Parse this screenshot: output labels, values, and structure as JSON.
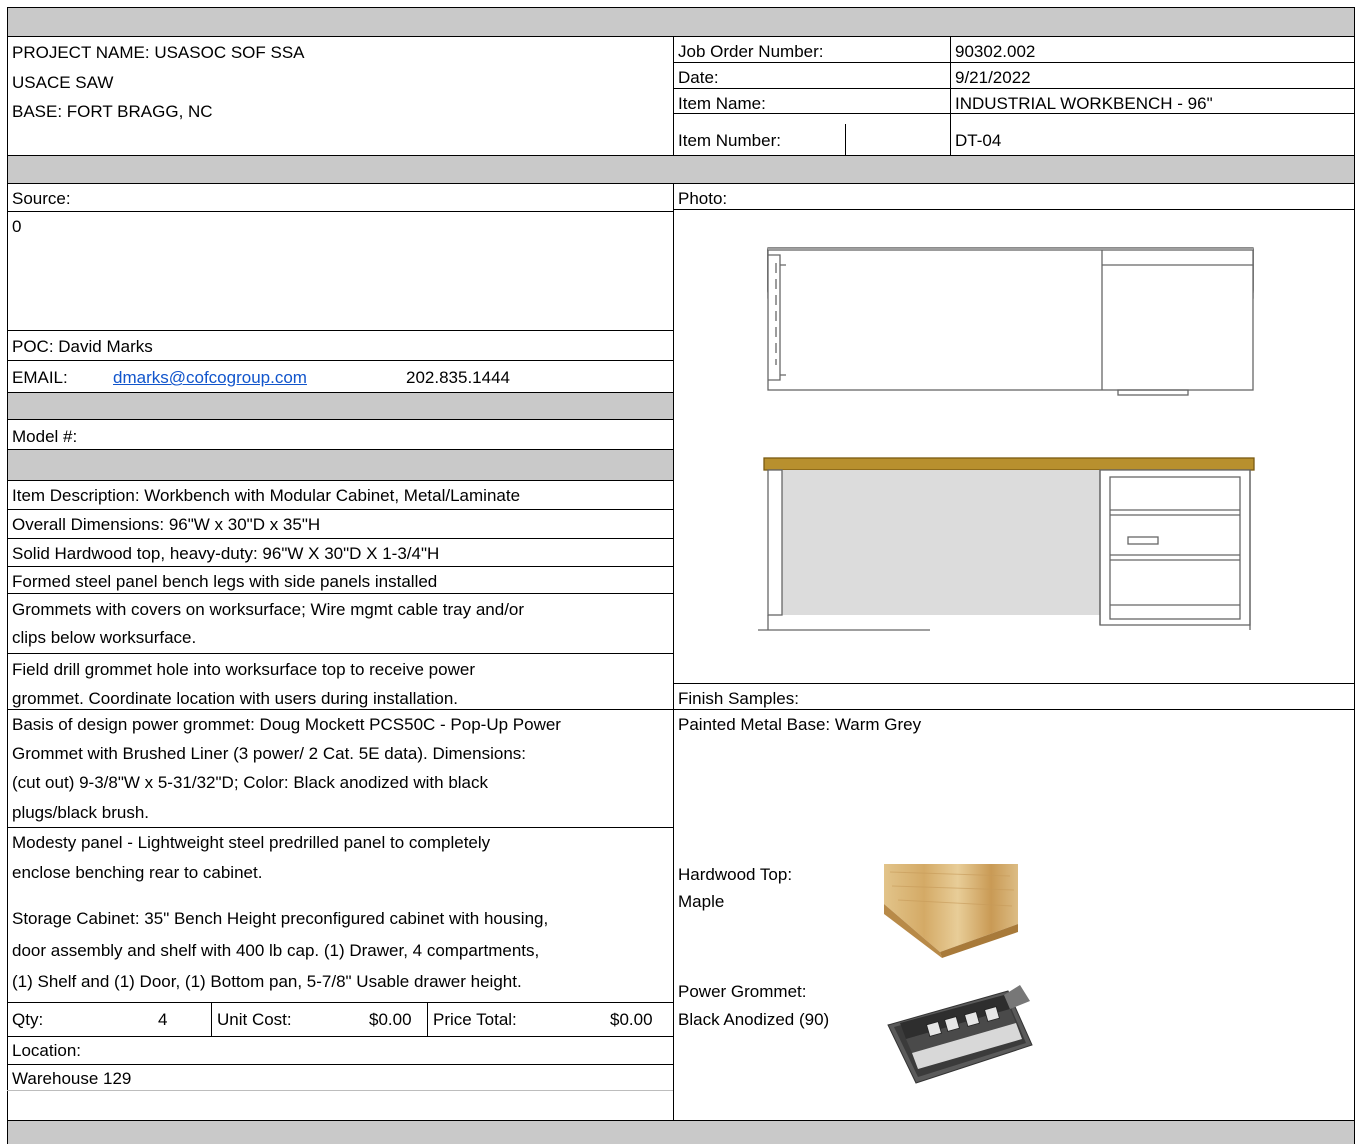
{
  "header": {
    "project": "PROJECT NAME: USASOC SOF SSA",
    "agency": "USACE SAW",
    "base": "BASE: FORT BRAGG, NC",
    "job_order_label": "Job Order Number:",
    "job_order_value": "90302.002",
    "date_label": "Date:",
    "date_value": "9/21/2022",
    "item_name_label": "Item Name:",
    "item_name_value": "INDUSTRIAL WORKBENCH - 96\"",
    "item_number_label": "Item Number:",
    "item_number_value": "DT-04"
  },
  "source": {
    "label": "Source:",
    "value": "0",
    "poc": "POC: David Marks",
    "email_label": "EMAIL:",
    "email": "dmarks@cofcogroup.com",
    "phone": "202.835.1444"
  },
  "model_label": "Model #:",
  "photo_label": "Photo:",
  "finish_label": "Finish Samples:",
  "description": [
    "Item Description: Workbench with Modular Cabinet, Metal/Laminate",
    "Overall Dimensions: 96\"W x 30\"D x 35\"H",
    "Solid Hardwood top, heavy-duty: 96\"W X 30\"D X 1-3/4\"H",
    "Formed steel panel bench legs with side panels installed",
    "Grommets with covers on worksurface; Wire mgmt cable tray and/or",
    "clips below worksurface.",
    "Field drill grommet hole into worksurface top to receive power",
    "grommet. Coordinate location with users during installation.",
    "Basis of design power grommet: Doug Mockett PCS50C - Pop-Up Power",
    "Grommet with Brushed Liner (3 power/ 2 Cat. 5E data). Dimensions:",
    "(cut out) 9-3/8\"W x 5-31/32\"D; Color: Black anodized with black",
    "plugs/black brush.",
    "Modesty panel - Lightweight steel predrilled panel to completely",
    "enclose benching rear to cabinet.",
    "Storage Cabinet: 35\" Bench Height preconfigured cabinet with housing,",
    "door assembly and shelf with 400 lb cap. (1) Drawer, 4 compartments,",
    "(1) Shelf and (1) Door, (1) Bottom pan, 5-7/8\" Usable drawer height."
  ],
  "pricing": {
    "qty_label": "Qty:",
    "qty": "4",
    "unit_cost_label": "Unit Cost:",
    "unit_cost": "$0.00",
    "price_total_label": "Price Total:",
    "price_total": "$0.00"
  },
  "location_label": "Location:",
  "location_value": "Warehouse 129",
  "finishes": {
    "metal_base": "Painted Metal Base: Warm Grey",
    "top_label_1": "Hardwood Top:",
    "top_label_2": "Maple",
    "grommet_label_1": "Power Grommet:",
    "grommet_label_2": "Black Anodized (90)"
  },
  "colors": {
    "band_grey": "#c9c9c9",
    "link_blue": "#1155cc",
    "wood_top": "#b8902e"
  }
}
